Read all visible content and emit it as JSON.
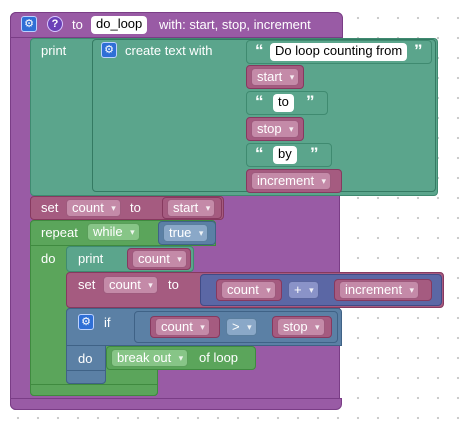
{
  "procedure": {
    "keyword_to": "to",
    "name": "do_loop",
    "params_label": "with: start, stop, increment"
  },
  "print1": {
    "label": "print",
    "create_text": "create text with",
    "items": {
      "s1": "Do loop counting from",
      "v1": "start",
      "s2": "to",
      "v2": "stop",
      "s3": "by",
      "v3": "increment"
    }
  },
  "set1": {
    "set": "set",
    "var": "count",
    "to": "to",
    "value": "start"
  },
  "repeat": {
    "label": "repeat",
    "mode": "while",
    "cond": "true",
    "do": "do"
  },
  "print2": {
    "label": "print",
    "var": "count"
  },
  "set2": {
    "set": "set",
    "var": "count",
    "to": "to",
    "left": "count",
    "op": "+",
    "right": "increment"
  },
  "if_block": {
    "label": "if",
    "left": "count",
    "op": ">",
    "right": "stop",
    "do": "do",
    "flow": "break out",
    "of_loop": "of loop"
  },
  "glyphs": {
    "open_quote": "“",
    "close_quote": "”",
    "gear": "⚙",
    "help": "?",
    "dropdown": "▾"
  }
}
